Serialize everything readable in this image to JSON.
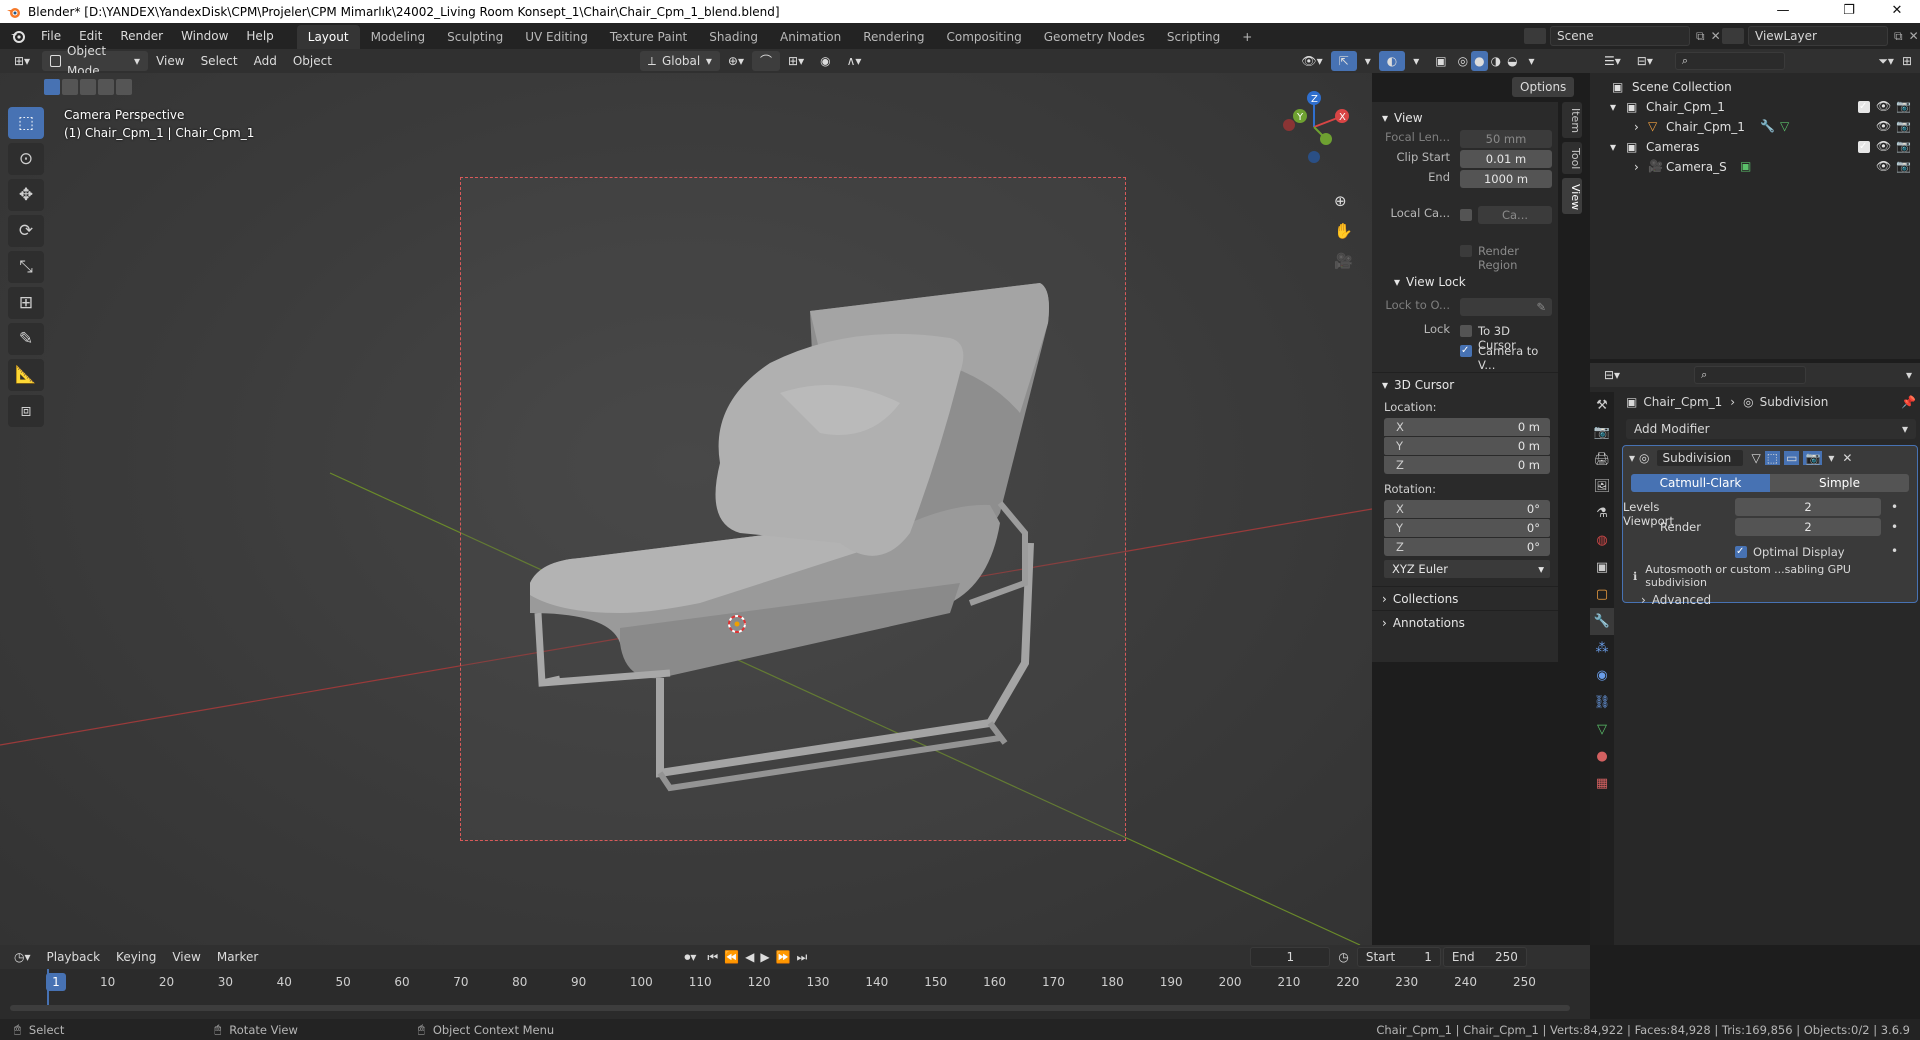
{
  "titlebar": {
    "title": "Blender* [D:\\YANDEX\\YandexDisk\\CPM\\Projeler\\CPM Mimarlık\\24002_Living Room Konsept_1\\Chair\\Chair_Cpm_1_blend.blend]",
    "min": "—",
    "max": "❐",
    "close": "✕"
  },
  "menu": [
    "File",
    "Edit",
    "Render",
    "Window",
    "Help"
  ],
  "workspaces": [
    "Layout",
    "Modeling",
    "Sculpting",
    "UV Editing",
    "Texture Paint",
    "Shading",
    "Animation",
    "Rendering",
    "Compositing",
    "Geometry Nodes",
    "Scripting"
  ],
  "workspace_add": "+",
  "scene": {
    "label": "Scene",
    "viewlayer": "ViewLayer"
  },
  "viewport_header": {
    "mode": "Object Mode",
    "menus": [
      "View",
      "Select",
      "Add",
      "Object"
    ],
    "orientation": "Global",
    "options": "Options"
  },
  "viewport": {
    "camera_label": "Camera Perspective",
    "object_label": "(1) Chair_Cpm_1 | Chair_Cpm_1",
    "gizmo": {
      "x": "X",
      "y": "Y",
      "z": "Z"
    }
  },
  "tools": [
    "select-box",
    "cursor",
    "move",
    "rotate",
    "scale",
    "transform",
    "annotate",
    "measure",
    "add-cube"
  ],
  "npanel": {
    "tabs": [
      "Item",
      "Tool",
      "View"
    ],
    "view": {
      "title": "View",
      "focal_label": "Focal Len...",
      "focal_value": "50 mm",
      "clip_start_label": "Clip Start",
      "clip_start_value": "0.01 m",
      "end_label": "End",
      "end_value": "1000 m",
      "local_cam_label": "Local Ca...",
      "local_cam_value": "Ca...",
      "render_region": "Render Region"
    },
    "view_lock": {
      "title": "View Lock",
      "lock_to_label": "Lock to O...",
      "lock_label": "Lock",
      "to_cursor": "To 3D Cursor",
      "camera_to_view": "Camera to V..."
    },
    "cursor": {
      "title": "3D Cursor",
      "location_label": "Location:",
      "loc": [
        {
          "axis": "X",
          "value": "0 m"
        },
        {
          "axis": "Y",
          "value": "0 m"
        },
        {
          "axis": "Z",
          "value": "0 m"
        }
      ],
      "rotation_label": "Rotation:",
      "rot": [
        {
          "axis": "X",
          "value": "0°"
        },
        {
          "axis": "Y",
          "value": "0°"
        },
        {
          "axis": "Z",
          "value": "0°"
        }
      ],
      "rotation_mode": "XYZ Euler"
    },
    "collections": "Collections",
    "annotations": "Annotations"
  },
  "outliner": {
    "search_placeholder": "",
    "rows": [
      {
        "name": "Scene Collection"
      },
      {
        "name": "Chair_Cpm_1"
      },
      {
        "name": "Chair_Cpm_1"
      },
      {
        "name": "Cameras"
      },
      {
        "name": "Camera_S"
      }
    ]
  },
  "properties": {
    "breadcrumb_object": "Chair_Cpm_1",
    "breadcrumb_modifier": "Subdivision",
    "add_modifier": "Add Modifier",
    "modifier": {
      "name": "Subdivision",
      "tab_catmull": "Catmull-Clark",
      "tab_simple": "Simple",
      "levels_viewport_label": "Levels Viewport",
      "levels_viewport_value": "2",
      "render_label": "Render",
      "render_value": "2",
      "optimal_display": "Optimal Display",
      "info": "Autosmooth or custom ...sabling GPU subdivision",
      "advanced": "Advanced"
    }
  },
  "timeline": {
    "menus": [
      "Playback",
      "Keying",
      "View",
      "Marker"
    ],
    "current_frame": "1",
    "start_label": "Start",
    "start": "1",
    "end_label": "End",
    "end": "250",
    "ticks": [
      "1",
      "10",
      "20",
      "30",
      "40",
      "50",
      "60",
      "70",
      "80",
      "90",
      "100",
      "110",
      "120",
      "130",
      "140",
      "150",
      "160",
      "170",
      "180",
      "190",
      "200",
      "210",
      "220",
      "230",
      "240",
      "250"
    ]
  },
  "statusbar": {
    "select": "Select",
    "rotate": "Rotate View",
    "context": "Object Context Menu",
    "stats": "Chair_Cpm_1 | Chair_Cpm_1 | Verts:84,922 | Faces:84,928 | Tris:169,856 | Objects:0/2 | 3.6.9"
  }
}
